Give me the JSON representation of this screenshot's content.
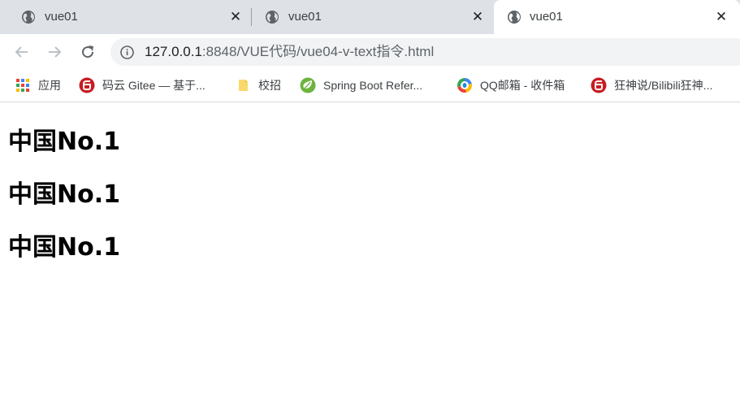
{
  "tabs": [
    {
      "title": "vue01",
      "icon": "globe-icon",
      "active": false
    },
    {
      "title": "vue01",
      "icon": "globe-icon",
      "active": false
    },
    {
      "title": "vue01",
      "icon": "globe-icon",
      "active": true
    }
  ],
  "toolbar": {
    "url_host": "127.0.0.1",
    "url_rest": ":8848/VUE代码/vue04-v-text指令.html"
  },
  "bookmarks": [
    {
      "label": "应用",
      "icon": "apps-grid-icon"
    },
    {
      "label": "码云 Gitee — 基于...",
      "icon": "gitee-logo-icon"
    },
    {
      "label": "校招",
      "icon": "folder-icon"
    },
    {
      "label": "Spring Boot Refer...",
      "icon": "spring-leaf-icon"
    },
    {
      "label": "QQ邮箱 - 收件箱",
      "icon": "qq-mail-icon"
    },
    {
      "label": "狂神说/Bilibili狂神...",
      "icon": "gitee-logo-icon"
    }
  ],
  "content": {
    "headings": [
      "中国No.1",
      "中国No.1",
      "中国No.1"
    ]
  },
  "colors": {
    "tab_strip": "#dee1e6",
    "omnibox": "#f1f3f4",
    "gitee_red": "#c71d23",
    "folder_yellow": "#f9d96b",
    "spring_green": "#6db33f"
  }
}
